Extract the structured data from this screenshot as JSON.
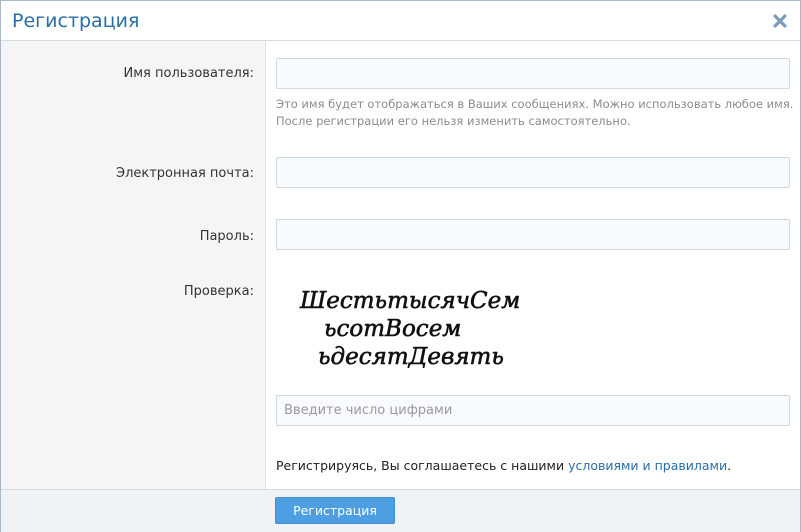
{
  "dialog": {
    "title": "Регистрация",
    "close_icon": "close-icon"
  },
  "form": {
    "username": {
      "label": "Имя пользователя:",
      "value": "",
      "hint_line1": "Это имя будет отображаться в Ваших сообщениях. Можно использовать любое имя.",
      "hint_line2": "После регистрации его нельзя изменить самостоятельно."
    },
    "email": {
      "label": "Электронная почта:",
      "value": ""
    },
    "password": {
      "label": "Пароль:",
      "value": ""
    },
    "captcha": {
      "label": "Проверка:",
      "image_lines": [
        "ШестьтысячСем",
        "ьсотВосем",
        "ьдесятДевять"
      ],
      "placeholder": "Введите число цифрами",
      "value": ""
    }
  },
  "agreement": {
    "text": "Регистрируясь, Вы соглашаетесь с нашими ",
    "link": "условиями и правилами",
    "suffix": "."
  },
  "footer": {
    "submit_label": "Регистрация"
  },
  "colors": {
    "title": "#2b6ea6",
    "link": "#2b6ea6",
    "button": "#4d9fe2"
  }
}
